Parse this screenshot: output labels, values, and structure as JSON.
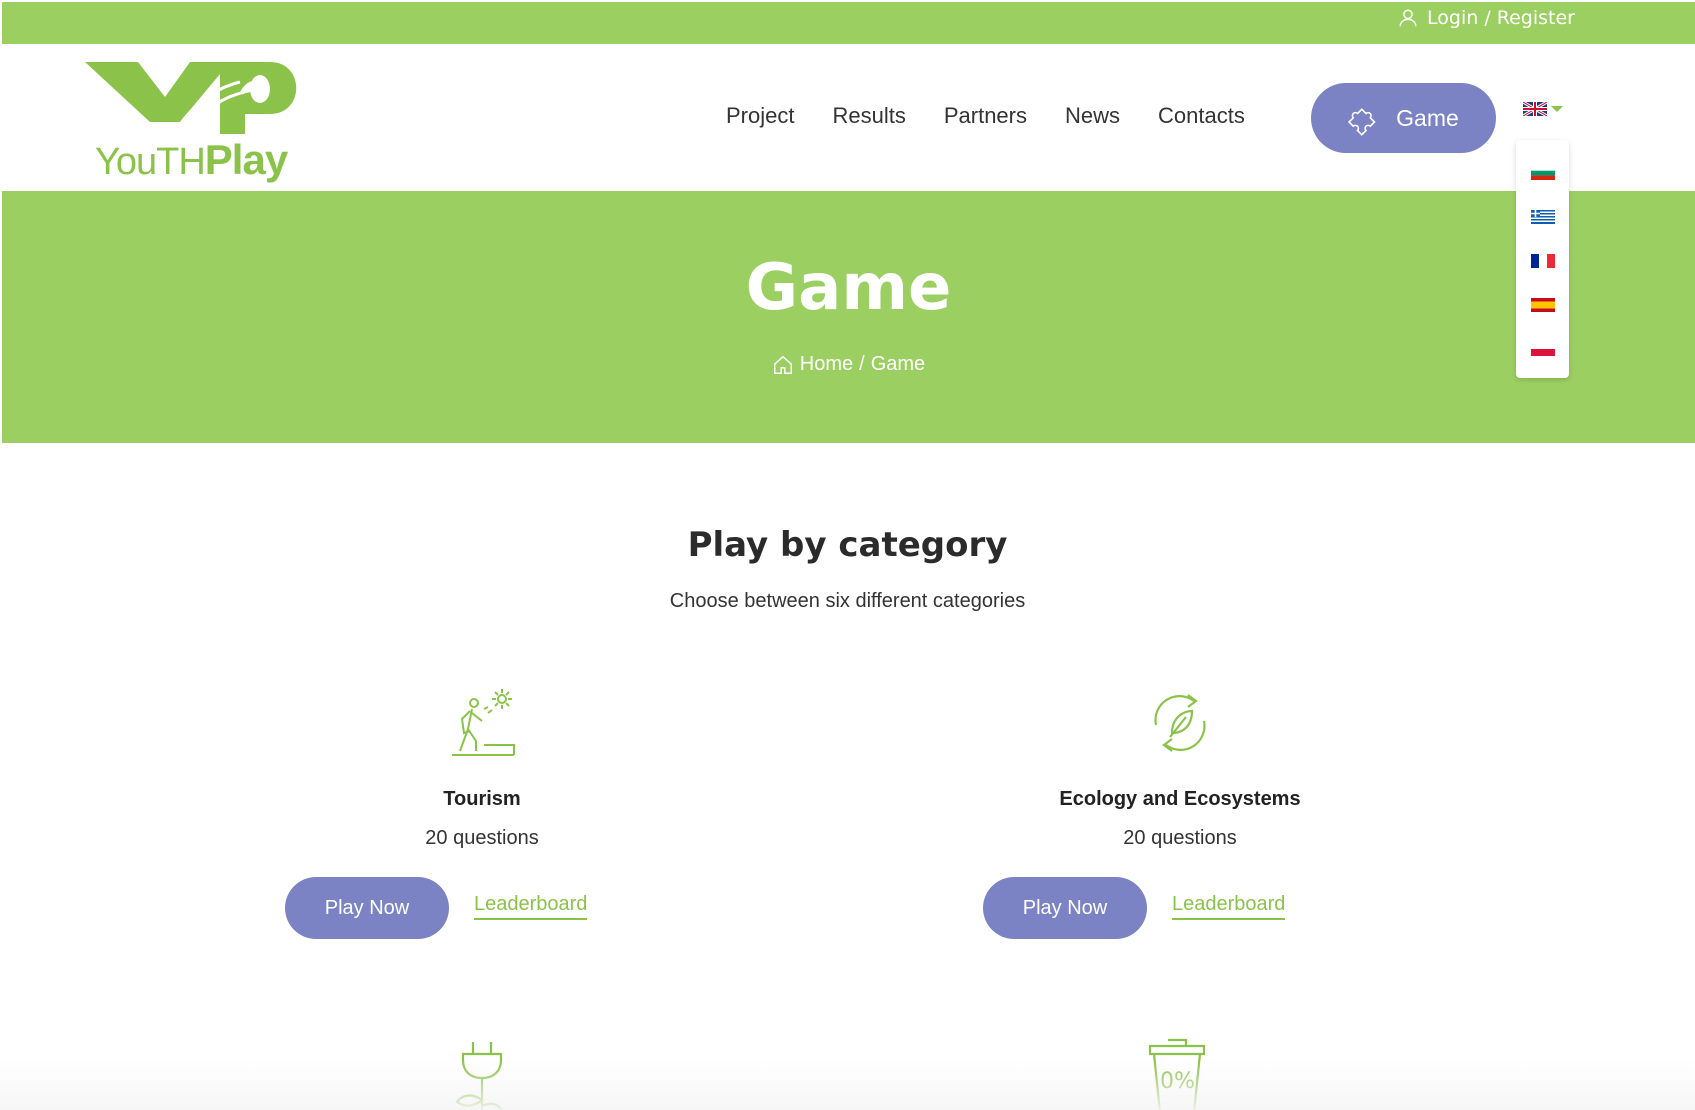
{
  "topbar": {
    "login_label": "Login / Register"
  },
  "logo": {
    "text_light": "YouTH",
    "text_bold": "Play",
    "letters": "YP"
  },
  "nav": {
    "items": [
      "Project",
      "Results",
      "Partners",
      "News",
      "Contacts"
    ]
  },
  "game_button": {
    "label": "Game"
  },
  "language": {
    "current": "en",
    "options": [
      "bg",
      "gr",
      "fr",
      "es",
      "pl"
    ]
  },
  "hero": {
    "title": "Game",
    "breadcrumb_home": "Home",
    "breadcrumb_sep": "/",
    "breadcrumb_current": "Game"
  },
  "section": {
    "title": "Play by category",
    "subtitle": "Choose between six different categories"
  },
  "categories": [
    {
      "name": "Tourism",
      "count": "20 questions",
      "play_label": "Play Now",
      "leaderboard_label": "Leaderboard",
      "icon": "hiker-icon"
    },
    {
      "name": "Ecology and Ecosystems",
      "count": "20 questions",
      "play_label": "Play Now",
      "leaderboard_label": "Leaderboard",
      "icon": "recycle-leaf-icon"
    }
  ],
  "bottom_icons": [
    "plug-plant-icon",
    "zero-waste-bin-icon"
  ],
  "bottom_icon_text": "0%",
  "colors": {
    "accent_green": "#9ccf62",
    "link_green": "#8bc34a",
    "button_purple": "#7b83c4"
  }
}
